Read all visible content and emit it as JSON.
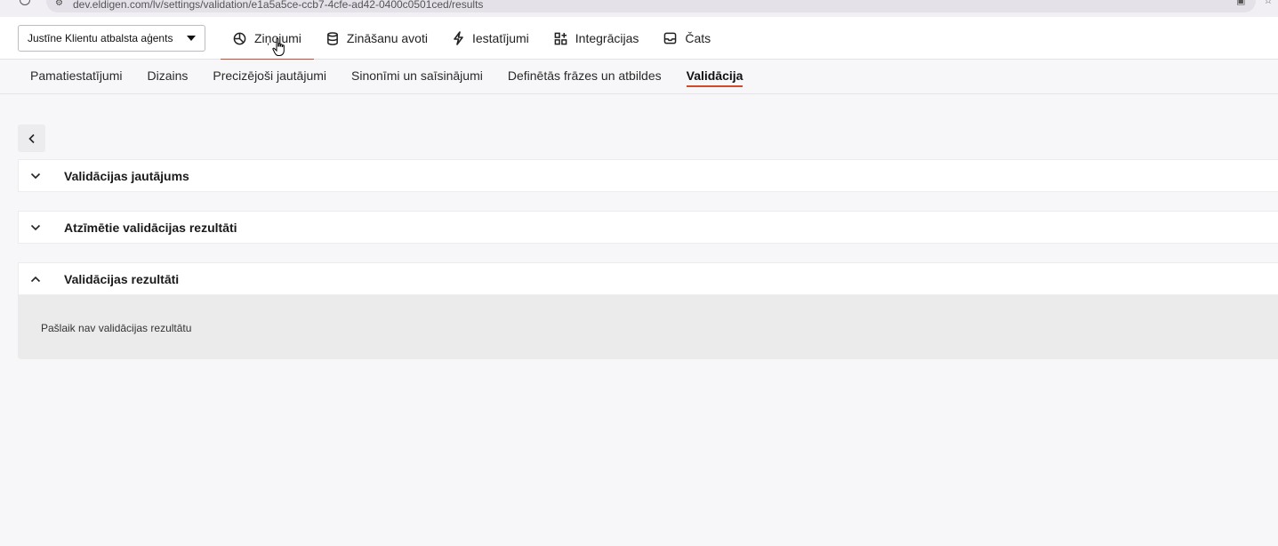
{
  "browser": {
    "url": "dev.eldigen.com/lv/settings/validation/e1a5a5ce-ccb7-4cfe-ad42-0400c0501ced/results"
  },
  "topbar": {
    "agent_select_value": "Justīne Klientu atbalsta aģents",
    "nav": [
      {
        "label": "Ziņojumi",
        "icon": "pie-chart-icon",
        "active": true
      },
      {
        "label": "Zināšanu avoti",
        "icon": "database-icon",
        "active": false
      },
      {
        "label": "Iestatījumi",
        "icon": "lightning-icon",
        "active": false
      },
      {
        "label": "Integrācijas",
        "icon": "grid-plus-icon",
        "active": false
      },
      {
        "label": "Čats",
        "icon": "inbox-icon",
        "active": false
      }
    ]
  },
  "subnav": {
    "tabs": [
      {
        "label": "Pamatiestatījumi",
        "active": false
      },
      {
        "label": "Dizains",
        "active": false
      },
      {
        "label": "Precizējoši jautājumi",
        "active": false
      },
      {
        "label": "Sinonīmi un saīsinājumi",
        "active": false
      },
      {
        "label": "Definētās frāzes un atbildes",
        "active": false
      },
      {
        "label": "Validācija",
        "active": true
      }
    ]
  },
  "main": {
    "back_icon": "chevron-left-icon",
    "panels": [
      {
        "title": "Validācijas jautājums",
        "expanded": false
      },
      {
        "title": "Atzīmētie validācijas rezultāti",
        "expanded": false
      },
      {
        "title": "Validācijas rezultāti",
        "expanded": true
      }
    ],
    "results_empty_text": "Pašlaik nav validācijas rezultātu"
  },
  "colors": {
    "accent": "#d24a2c",
    "background": "#f7f6f8",
    "panel_body": "#ebebeb"
  }
}
